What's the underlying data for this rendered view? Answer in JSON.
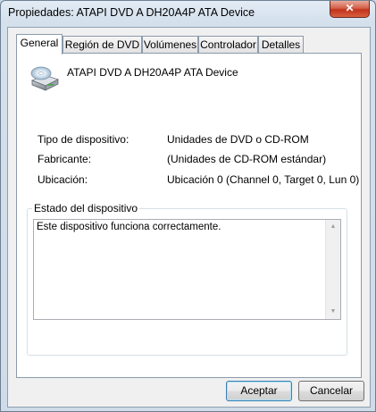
{
  "window": {
    "title": "Propiedades: ATAPI DVD A  DH20A4P ATA Device",
    "close_glyph": "✕"
  },
  "tabs": [
    {
      "label": "General",
      "active": true
    },
    {
      "label": "Región de DVD"
    },
    {
      "label": "Volúmenes"
    },
    {
      "label": "Controlador"
    },
    {
      "label": "Detalles"
    }
  ],
  "device": {
    "icon": "dvd-drive-icon",
    "name": "ATAPI DVD A  DH20A4P ATA Device"
  },
  "properties": [
    {
      "label": "Tipo de dispositivo:",
      "value": "Unidades de DVD o CD-ROM"
    },
    {
      "label": "Fabricante:",
      "value": "(Unidades de CD-ROM estándar)"
    },
    {
      "label": "Ubicación:",
      "value": "Ubicación 0 (Channel 0, Target 0, Lun 0)"
    }
  ],
  "status": {
    "group_label": "Estado del dispositivo",
    "text": "Este dispositivo funciona correctamente."
  },
  "buttons": {
    "ok": "Aceptar",
    "cancel": "Cancelar"
  }
}
